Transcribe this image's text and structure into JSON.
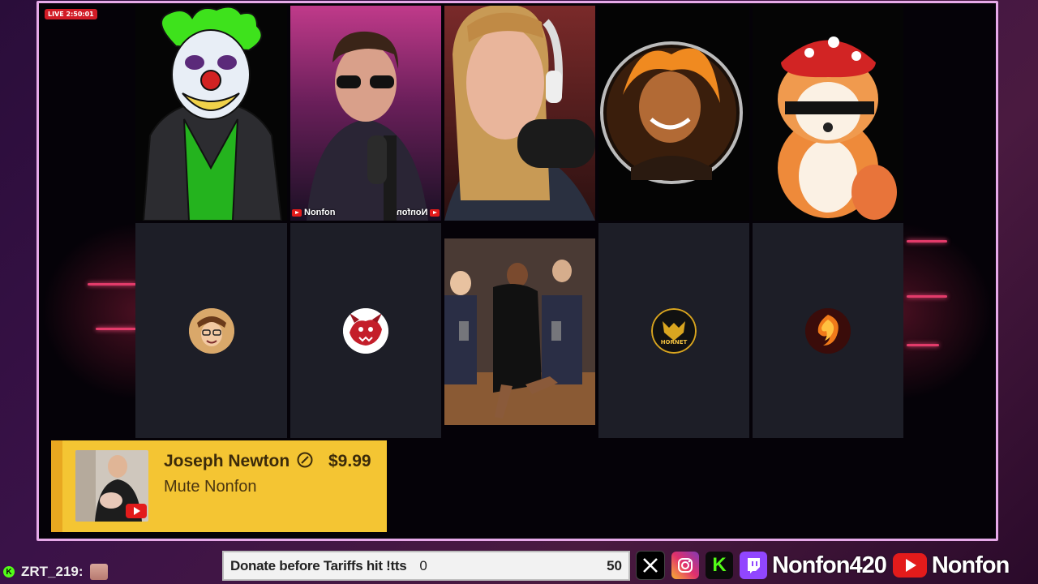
{
  "overlay": {
    "live_badge": "LIVE 2:50:01"
  },
  "participants": [
    {
      "id": "joker-avatar",
      "kind": "cam"
    },
    {
      "id": "nonfon-cam",
      "kind": "cam",
      "tag_left": "Nonfon",
      "tag_right": "Nonfon"
    },
    {
      "id": "headset-cam",
      "kind": "cam"
    },
    {
      "id": "fire-portrait",
      "kind": "cam"
    },
    {
      "id": "fox-avatar",
      "kind": "cam"
    },
    {
      "id": "audio-only-1",
      "kind": "avatar"
    },
    {
      "id": "audio-only-2",
      "kind": "avatar"
    },
    {
      "id": "shared-photo",
      "kind": "image"
    },
    {
      "id": "audio-only-3",
      "kind": "avatar",
      "logo_text": "HORNET"
    },
    {
      "id": "audio-only-4",
      "kind": "avatar"
    }
  ],
  "donation": {
    "name": "Joseph Newton",
    "amount": "$9.99",
    "message": "Mute Nonfon"
  },
  "chat": {
    "username": "ZRT_219:"
  },
  "goal": {
    "title": "Donate before Tariffs hit !tts",
    "current": "0",
    "target": "50"
  },
  "socials": {
    "twitch_handle": "Nonfon420",
    "youtube_handle": "Nonfon",
    "kick_glyph": "K"
  },
  "colors": {
    "stage_border": "#e6a9e8",
    "donation_bg": "#f4c533",
    "live_red": "#d21b26",
    "kick_green": "#53fc18",
    "twitch_purple": "#9146ff",
    "youtube_red": "#e31b1b"
  }
}
